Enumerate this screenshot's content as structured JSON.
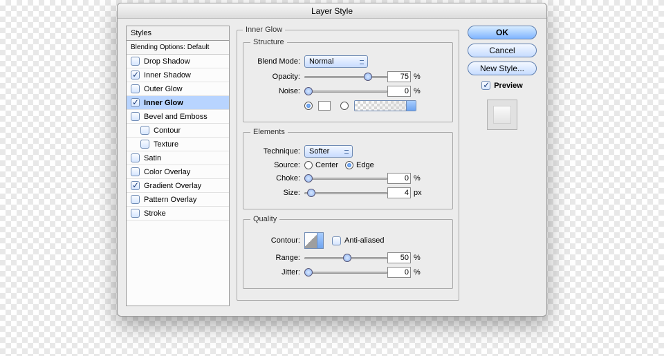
{
  "window": {
    "title": "Layer Style"
  },
  "styles_panel": {
    "header": "Styles",
    "subheader": "Blending Options: Default",
    "items": [
      {
        "label": "Drop Shadow",
        "checked": false,
        "selected": false,
        "indent": false
      },
      {
        "label": "Inner Shadow",
        "checked": true,
        "selected": false,
        "indent": false
      },
      {
        "label": "Outer Glow",
        "checked": false,
        "selected": false,
        "indent": false
      },
      {
        "label": "Inner Glow",
        "checked": true,
        "selected": true,
        "indent": false
      },
      {
        "label": "Bevel and Emboss",
        "checked": false,
        "selected": false,
        "indent": false
      },
      {
        "label": "Contour",
        "checked": false,
        "selected": false,
        "indent": true
      },
      {
        "label": "Texture",
        "checked": false,
        "selected": false,
        "indent": true
      },
      {
        "label": "Satin",
        "checked": false,
        "selected": false,
        "indent": false
      },
      {
        "label": "Color Overlay",
        "checked": false,
        "selected": false,
        "indent": false
      },
      {
        "label": "Gradient Overlay",
        "checked": true,
        "selected": false,
        "indent": false
      },
      {
        "label": "Pattern Overlay",
        "checked": false,
        "selected": false,
        "indent": false
      },
      {
        "label": "Stroke",
        "checked": false,
        "selected": false,
        "indent": false
      }
    ]
  },
  "panel_title": "Inner Glow",
  "structure": {
    "legend": "Structure",
    "blend_mode_label": "Blend Mode:",
    "blend_mode_value": "Normal",
    "opacity_label": "Opacity:",
    "opacity_value": "75",
    "opacity_unit": "%",
    "noise_label": "Noise:",
    "noise_value": "0",
    "noise_unit": "%",
    "color_radio_selected": "solid"
  },
  "elements": {
    "legend": "Elements",
    "technique_label": "Technique:",
    "technique_value": "Softer",
    "source_label": "Source:",
    "source_center": "Center",
    "source_edge": "Edge",
    "source_value": "edge",
    "choke_label": "Choke:",
    "choke_value": "0",
    "choke_unit": "%",
    "size_label": "Size:",
    "size_value": "4",
    "size_unit": "px"
  },
  "quality": {
    "legend": "Quality",
    "contour_label": "Contour:",
    "antialiased_label": "Anti-aliased",
    "antialiased_checked": false,
    "range_label": "Range:",
    "range_value": "50",
    "range_unit": "%",
    "jitter_label": "Jitter:",
    "jitter_value": "0",
    "jitter_unit": "%"
  },
  "buttons": {
    "ok": "OK",
    "cancel": "Cancel",
    "new_style": "New Style..."
  },
  "preview": {
    "label": "Preview",
    "checked": true
  }
}
